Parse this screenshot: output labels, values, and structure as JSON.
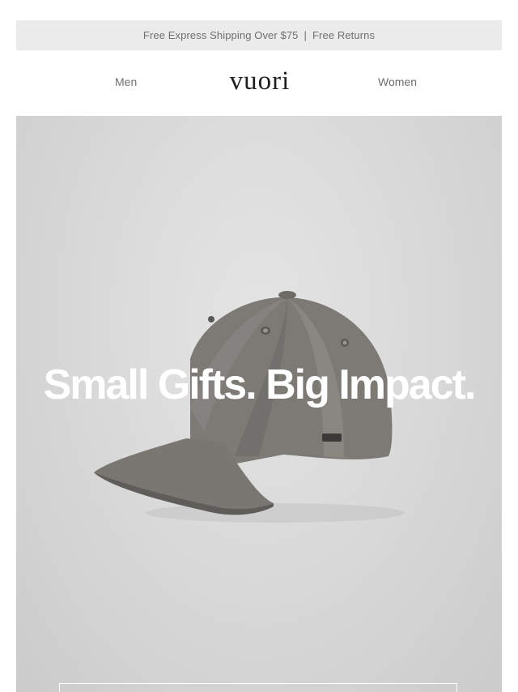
{
  "promo": {
    "shipping": "Free Express Shipping Over $75",
    "separator": "|",
    "returns": "Free Returns"
  },
  "nav": {
    "men": "Men",
    "logo": "vuori",
    "women": "Women"
  },
  "hero": {
    "headline": "Small Gifts. Big Impact.",
    "product_icon": "cap-illustration",
    "background_color": "#dadada",
    "cap_color": "#7d7a76"
  }
}
